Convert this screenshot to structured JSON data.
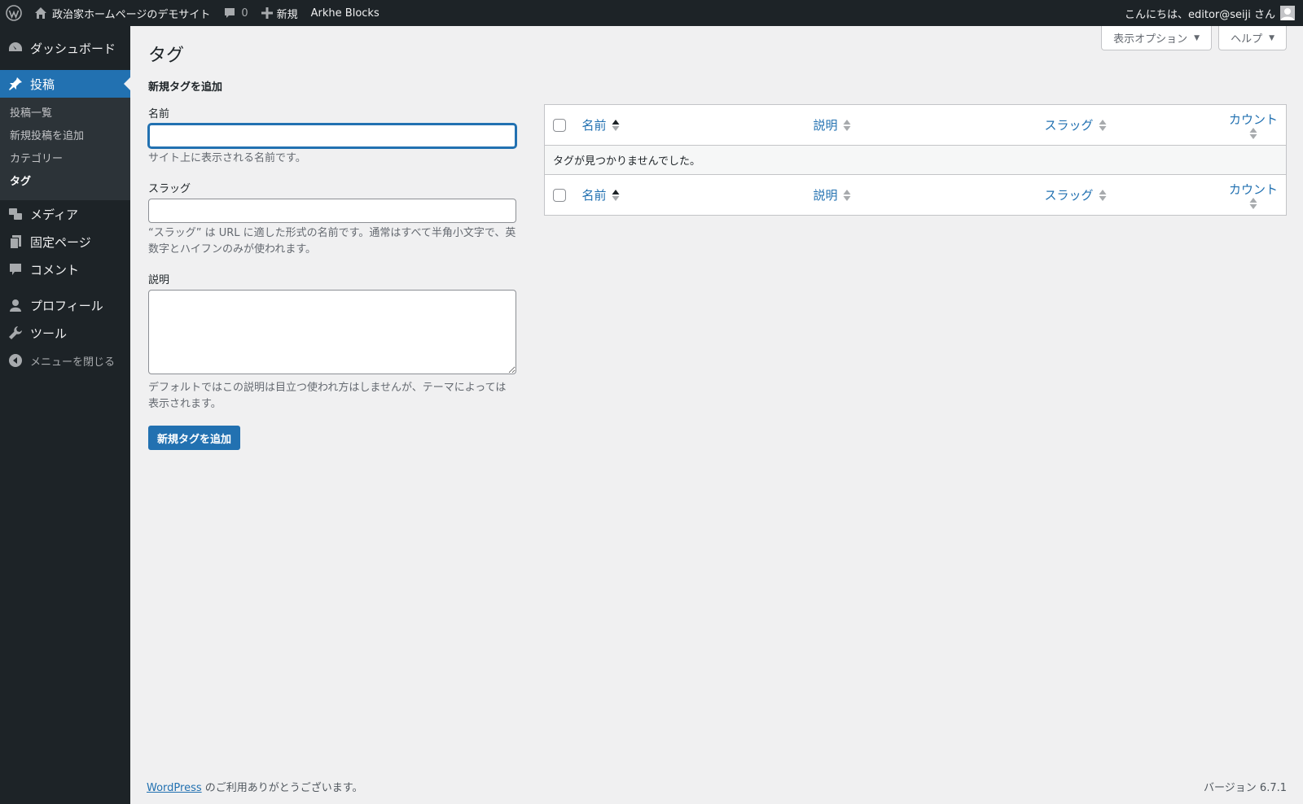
{
  "adminbar": {
    "site_name": "政治家ホームページのデモサイト",
    "comments_count": "0",
    "new_label": "新規",
    "plugin_label": "Arkhe Blocks",
    "greeting": "こんにちは、editor@seiji さん"
  },
  "sidebar": {
    "items": [
      {
        "label": "ダッシュボード",
        "icon": "dashboard-icon"
      },
      {
        "label": "投稿",
        "icon": "pin-icon"
      },
      {
        "label": "メディア",
        "icon": "media-icon"
      },
      {
        "label": "固定ページ",
        "icon": "page-icon"
      },
      {
        "label": "コメント",
        "icon": "comment-icon"
      },
      {
        "label": "プロフィール",
        "icon": "user-icon"
      },
      {
        "label": "ツール",
        "icon": "wrench-icon"
      },
      {
        "label": "メニューを閉じる",
        "icon": "collapse-icon"
      }
    ],
    "submenu": [
      "投稿一覧",
      "新規投稿を追加",
      "カテゴリー",
      "タグ"
    ]
  },
  "screen_meta": {
    "options_label": "表示オプション",
    "help_label": "ヘルプ"
  },
  "page": {
    "title": "タグ"
  },
  "form": {
    "heading": "新規タグを追加",
    "name_label": "名前",
    "name_value": "",
    "name_help": "サイト上に表示される名前です。",
    "slug_label": "スラッグ",
    "slug_value": "",
    "slug_help": "“スラッグ” は URL に適した形式の名前です。通常はすべて半角小文字で、英数字とハイフンのみが使われます。",
    "desc_label": "説明",
    "desc_help": "デフォルトではこの説明は目立つ使われ方はしませんが、テーマによっては表示されます。",
    "submit_label": "新規タグを追加"
  },
  "table": {
    "columns": [
      "名前",
      "説明",
      "スラッグ",
      "カウント"
    ],
    "empty_message": "タグが見つかりませんでした。"
  },
  "footer": {
    "wp_link": "WordPress",
    "thanks": " のご利用ありがとうございます。",
    "version": "バージョン 6.7.1"
  },
  "colors": {
    "adminbar_bg": "#1d2327",
    "accent": "#2271b1",
    "page_bg": "#f0f0f1"
  }
}
